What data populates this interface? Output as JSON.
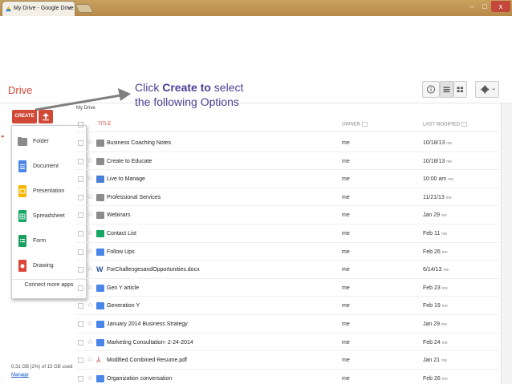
{
  "browser": {
    "tab_title": "My Drive - Google Drive",
    "tab_close": "×",
    "minimize": "–",
    "maximize": "□",
    "close": "x"
  },
  "drive": {
    "logo": "Drive",
    "breadcrumb": "My Drive",
    "storage": "0.31 GB (2%) of 15 GB used",
    "manage": "Manage"
  },
  "annotation": {
    "prefix": "Click ",
    "bold": "Create to",
    "line1_rest": " select",
    "line2": "the following Options",
    "color": "#4c3e97"
  },
  "toolbar": {
    "create_label": "CREATE",
    "upload_icon": "upload-icon",
    "info_icon": "info-icon",
    "list_view_icon": "list-view-icon",
    "grid_view_icon": "grid-view-icon",
    "settings_icon": "gear-icon",
    "accent_color": "#d14836"
  },
  "create_menu": {
    "items": [
      {
        "label": "Folder",
        "icon": "folder-icon"
      },
      {
        "label": "Document",
        "icon": "document-icon"
      },
      {
        "label": "Presentation",
        "icon": "presentation-icon"
      },
      {
        "label": "Spreadsheet",
        "icon": "spreadsheet-icon"
      },
      {
        "label": "Form",
        "icon": "form-icon"
      },
      {
        "label": "Drawing",
        "icon": "drawing-icon"
      }
    ],
    "footer": "Connect more apps"
  },
  "file_list": {
    "columns": {
      "title": "TITLE",
      "owner": "OWNER",
      "modified": "LAST MODIFIED"
    },
    "rows": [
      {
        "name": "Business Coaching Notes",
        "type": "folder",
        "owner": "me",
        "modified": "10/18/13",
        "by": "me"
      },
      {
        "name": "Create to Educate",
        "type": "folder",
        "owner": "me",
        "modified": "10/18/13",
        "by": "me"
      },
      {
        "name": "Live to Manage",
        "type": "folder-shared",
        "owner": "me",
        "modified": "10:00 am",
        "by": "me"
      },
      {
        "name": "Professional Services",
        "type": "folder",
        "owner": "me",
        "modified": "11/21/13",
        "by": "me"
      },
      {
        "name": "Webinars",
        "type": "folder",
        "owner": "me",
        "modified": "Jan 29",
        "by": "me"
      },
      {
        "name": "Contact List",
        "type": "sheet",
        "owner": "me",
        "modified": "Feb 11",
        "by": "me"
      },
      {
        "name": "Follow Ups",
        "type": "doc",
        "owner": "me",
        "modified": "Feb 26",
        "by": "me"
      },
      {
        "name": "ForChallengesandOpportunities.docx",
        "type": "word",
        "owner": "me",
        "modified": "6/14/13",
        "by": "me"
      },
      {
        "name": "Gen Y article",
        "type": "doc",
        "owner": "me",
        "modified": "Feb 23",
        "by": "me"
      },
      {
        "name": "Generation Y",
        "type": "doc",
        "owner": "me",
        "modified": "Feb 19",
        "by": "me"
      },
      {
        "name": "January 2014 Business Strategy",
        "type": "doc",
        "owner": "me",
        "modified": "Jan 29",
        "by": "me"
      },
      {
        "name": "Marketing Consultation- 2-24-2014",
        "type": "doc",
        "owner": "me",
        "modified": "Feb 24",
        "by": "me"
      },
      {
        "name": "Modified Combined Resume.pdf",
        "type": "pdf",
        "owner": "me",
        "modified": "Jan 21",
        "by": "me"
      },
      {
        "name": "Organization conversation",
        "type": "doc",
        "owner": "me",
        "modified": "Feb 26",
        "by": "me"
      }
    ]
  }
}
